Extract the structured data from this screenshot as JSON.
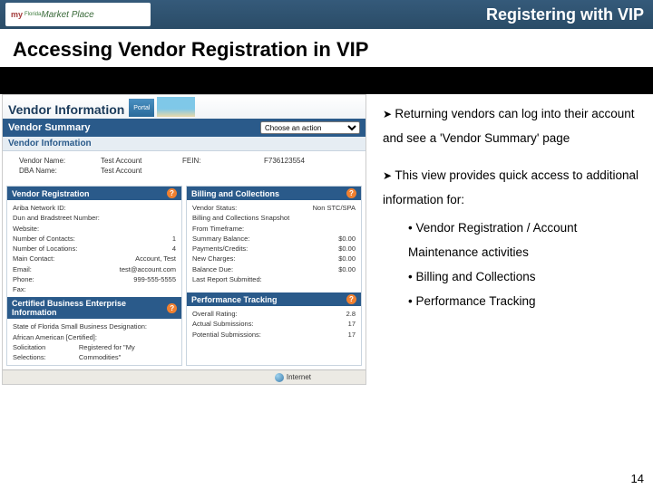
{
  "topbar": {
    "logo_prefix": "my",
    "logo_suffix": "Market Place",
    "logo_state": "Florida",
    "title": "Registering with VIP"
  },
  "heading": "Accessing Vendor Registration in VIP",
  "shot": {
    "vip_big": "Vendor Information",
    "vip_small": "Portal",
    "vendor_summary": "Vendor Summary",
    "choose_action": "Choose an action",
    "vendor_information": "Vendor Information",
    "rows": {
      "vendor_name_lbl": "Vendor Name:",
      "vendor_name_val": "Test Account",
      "fein_lbl": "FEIN:",
      "fein_val": "F736123554",
      "dba_lbl": "DBA Name:",
      "dba_val": "Test Account"
    },
    "card_reg": {
      "title": "Vendor Registration",
      "r1l": "Ariba Network ID:",
      "r1v": "",
      "r2l": "Dun and Bradstreet Number:",
      "r2v": "",
      "r3l": "Website:",
      "r3v": "",
      "r4l": "Number of Contacts:",
      "r4v": "1",
      "r5l": "Number of Locations:",
      "r5v": "4",
      "r6l": "Main Contact:",
      "r6v": "Account, Test",
      "r7": "Email:",
      "r7v": "test@account.com",
      "r8": "Phone:",
      "r8v": "999-555-5555",
      "r9": "Fax:",
      "r9v": "",
      "cbe_title": "Certified Business Enterprise Information",
      "cbe_r1l": "State of Florida Small Business Designation:",
      "cbe_r1v": "",
      "cbe_r2l": "African American [Certified]:",
      "cbe_r2v": "",
      "cbe_r3l": "Solicitation Selections:",
      "cbe_r3v": "Registered for \"My Commodities\""
    },
    "card_bill": {
      "title": "Billing and Collections",
      "r1l": "Vendor Status:",
      "r1v": "Non STC/SPA",
      "r2l": "Billing and Collections Snapshot",
      "r2v": "",
      "r3l": "From Timeframe:",
      "r3v": "",
      "r4l": "Summary Balance:",
      "r4v": "$0.00",
      "r5l": "Payments/Credits:",
      "r5v": "$0.00",
      "r6l": "New Charges:",
      "r6v": "$0.00",
      "r7l": "Balance Due:",
      "r7v": "$0.00",
      "r8l": "Last Report Submitted:",
      "r8v": ""
    },
    "card_perf": {
      "title": "Performance Tracking",
      "r1l": "Overall Rating:",
      "r1v": "2.8",
      "r2l": "Actual Submissions:",
      "r2v": "17",
      "r3l": "Potential Submissions:",
      "r3v": "17"
    },
    "status": "Internet"
  },
  "bullets": {
    "b1": "Returning vendors can log into their account and see a 'Vendor Summary' page",
    "b2": "This view provides quick access to additional information for:",
    "s1": "Vendor Registration / Account Maintenance activities",
    "s2": "Billing and Collections",
    "s3": "Performance Tracking"
  },
  "pagenum": "14"
}
